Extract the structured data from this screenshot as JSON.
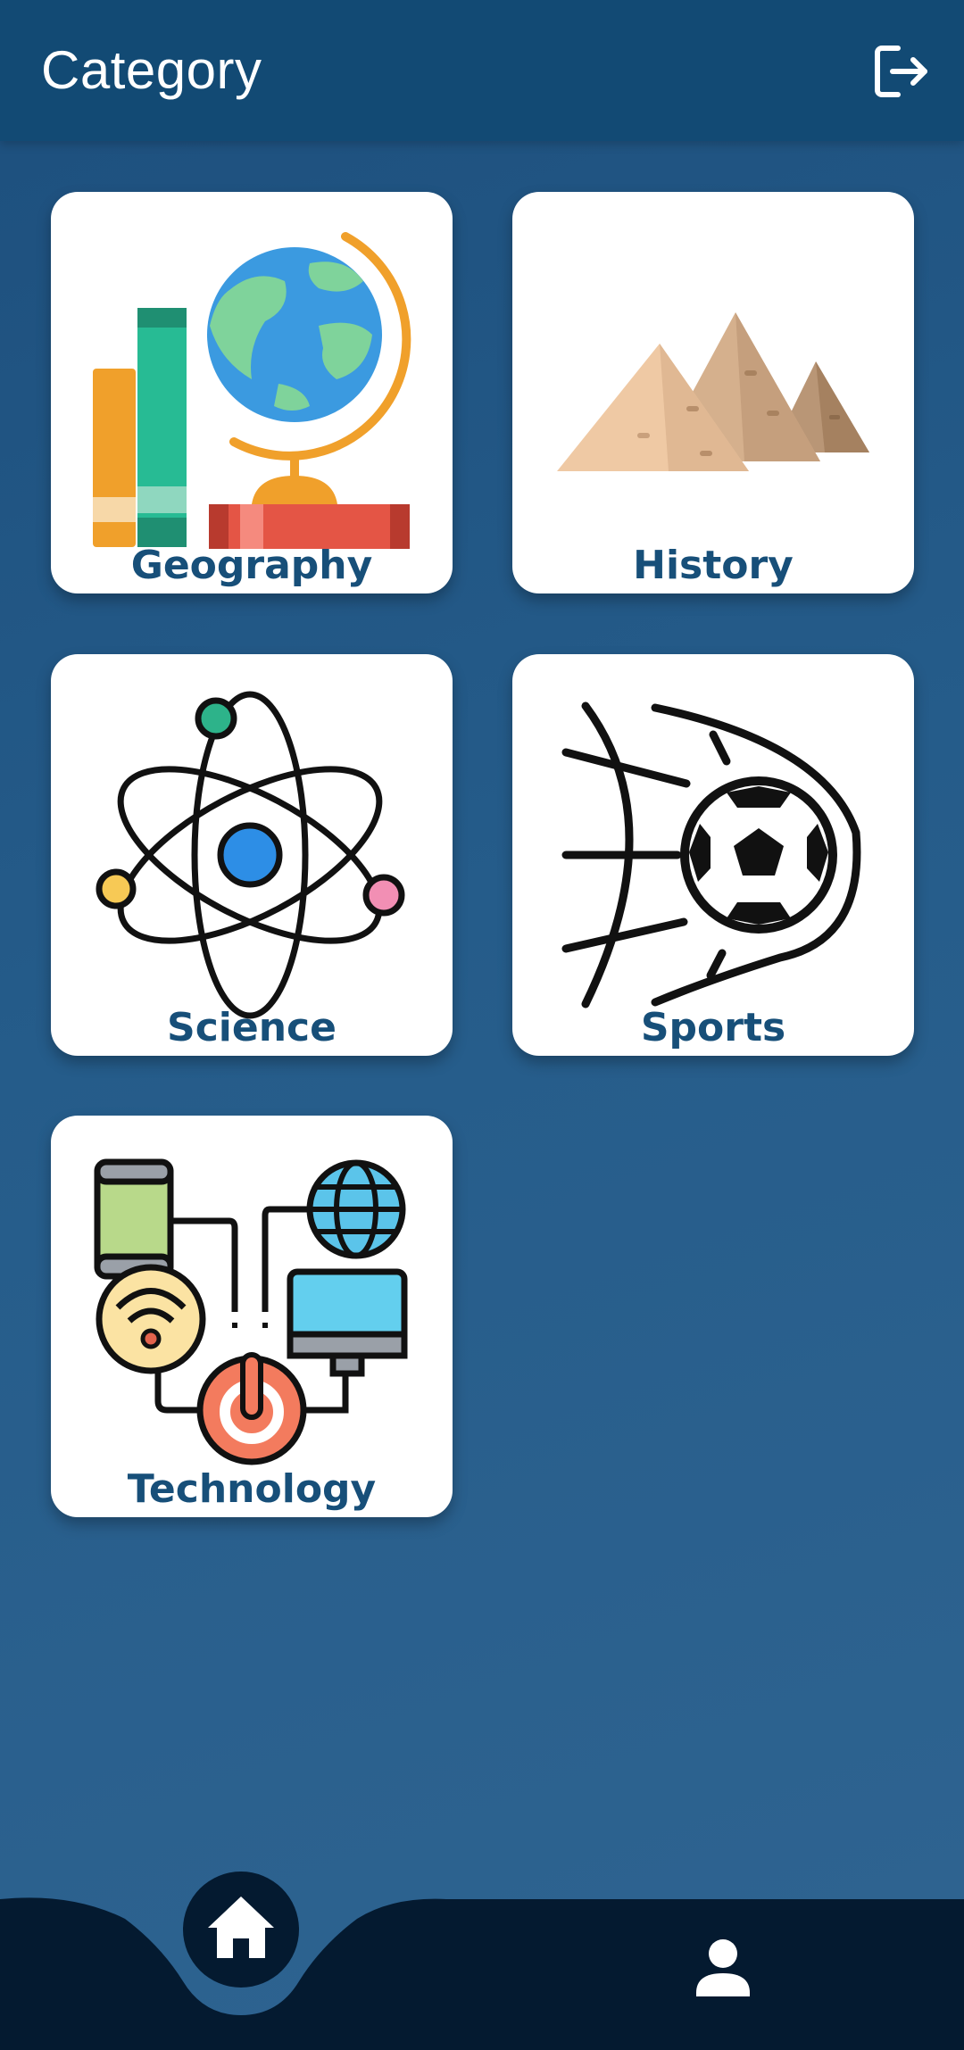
{
  "header": {
    "title": "Category"
  },
  "icons": {
    "logout": "logout-icon",
    "home": "home-icon",
    "profile": "person-icon"
  },
  "categories": [
    {
      "label": "Geography",
      "icon": "globe-books-icon"
    },
    {
      "label": "History",
      "icon": "pyramids-icon"
    },
    {
      "label": "Science",
      "icon": "atom-icon"
    },
    {
      "label": "Sports",
      "icon": "soccer-ball-icon"
    },
    {
      "label": "Technology",
      "icon": "devices-network-icon"
    }
  ],
  "colors": {
    "appbar": "#124a74",
    "background": "#255c8a",
    "card": "#ffffff",
    "label": "#174f79",
    "bottom_nav": "#041a30"
  }
}
